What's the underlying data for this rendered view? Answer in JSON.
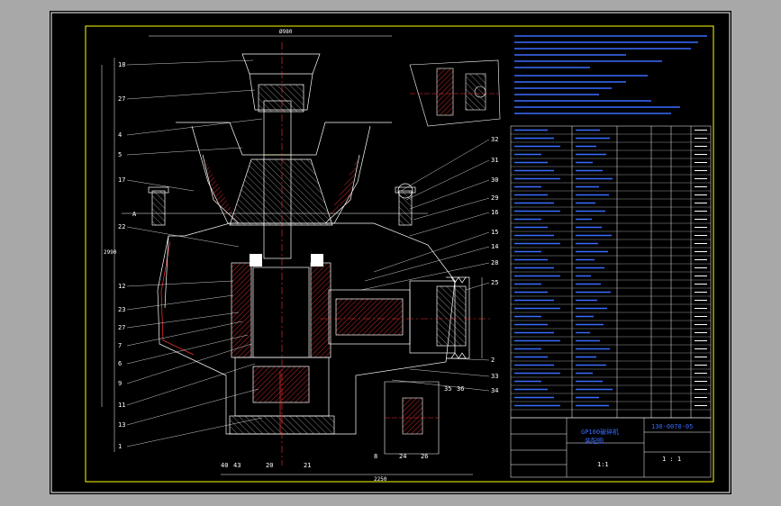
{
  "title_block": {
    "drawing_no": "130-0070-05",
    "name_line1": "GP100破碎机",
    "name_line2": "装配图",
    "scale": "1:1",
    "sheet": "1 : 1"
  },
  "part_labels_left": [
    "18",
    "27",
    "4",
    "5",
    "17",
    "22",
    "12",
    "23",
    "27",
    "7",
    "6",
    "9",
    "11",
    "13",
    "1"
  ],
  "part_labels_right": [
    "32",
    "31",
    "30",
    "29",
    "16",
    "15",
    "14",
    "28",
    "25",
    "2",
    "33",
    "34"
  ],
  "part_labels_bottom": [
    "40",
    "43",
    "20",
    "21",
    "8",
    "24",
    "26",
    "35",
    "36"
  ],
  "dimensions": {
    "top_width": "Ø980",
    "bottom_width": "2250",
    "height": "2990"
  },
  "section_label": "A",
  "colors": {
    "background": "#000000",
    "frame": "#ffff00",
    "outline": "#ffffff",
    "notes": "#3a6cff",
    "hatch": "#ff3333",
    "axis": "#ff3333"
  }
}
